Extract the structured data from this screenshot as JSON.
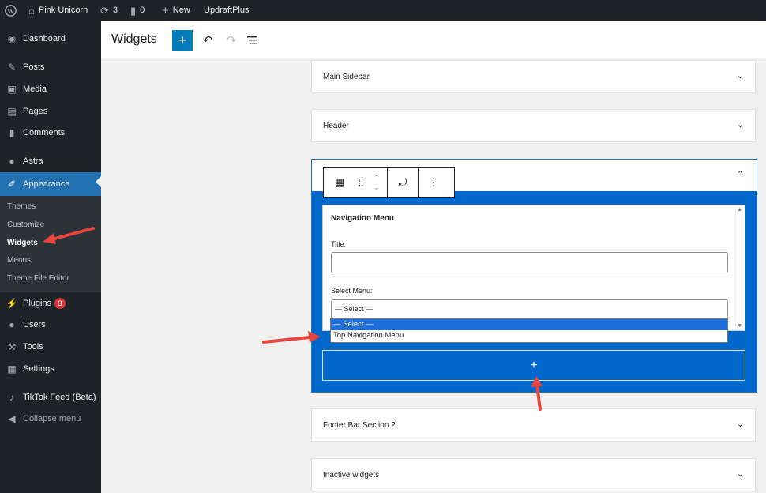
{
  "admin_bar": {
    "wp_logo_icon": "wordpress-icon",
    "site_name": "Pink Unicorn",
    "updates_count": "3",
    "comments_count": "0",
    "new_label": "New",
    "plugin_label": "UpdraftPlus"
  },
  "sidebar": {
    "dashboard": "Dashboard",
    "posts": "Posts",
    "media": "Media",
    "pages": "Pages",
    "comments": "Comments",
    "astra": "Astra",
    "appearance": "Appearance",
    "submenu": {
      "themes": "Themes",
      "customize": "Customize",
      "widgets": "Widgets",
      "menus": "Menus",
      "theme_file_editor": "Theme File Editor"
    },
    "plugins": "Plugins",
    "plugins_badge": "3",
    "users": "Users",
    "tools": "Tools",
    "settings": "Settings",
    "tiktok": "TikTok Feed (Beta)",
    "collapse": "Collapse menu"
  },
  "header": {
    "title": "Widgets"
  },
  "widget_areas": {
    "main_sidebar": "Main Sidebar",
    "header": "Header",
    "footer_bar_section_2": "Footer Bar Section 2",
    "inactive_widgets": "Inactive widgets"
  },
  "nav_menu_widget": {
    "title": "Navigation Menu",
    "title_label": "Title:",
    "title_value": "",
    "select_label": "Select Menu:",
    "selected_value": "— Select —",
    "options": [
      "— Select —",
      "Top Navigation Menu"
    ]
  },
  "colors": {
    "admin_dark": "#1d2327",
    "accent_blue": "#2271b1",
    "area_blue": "#0067cc",
    "badge_red": "#d63638",
    "annotation_red": "#e8453c"
  }
}
